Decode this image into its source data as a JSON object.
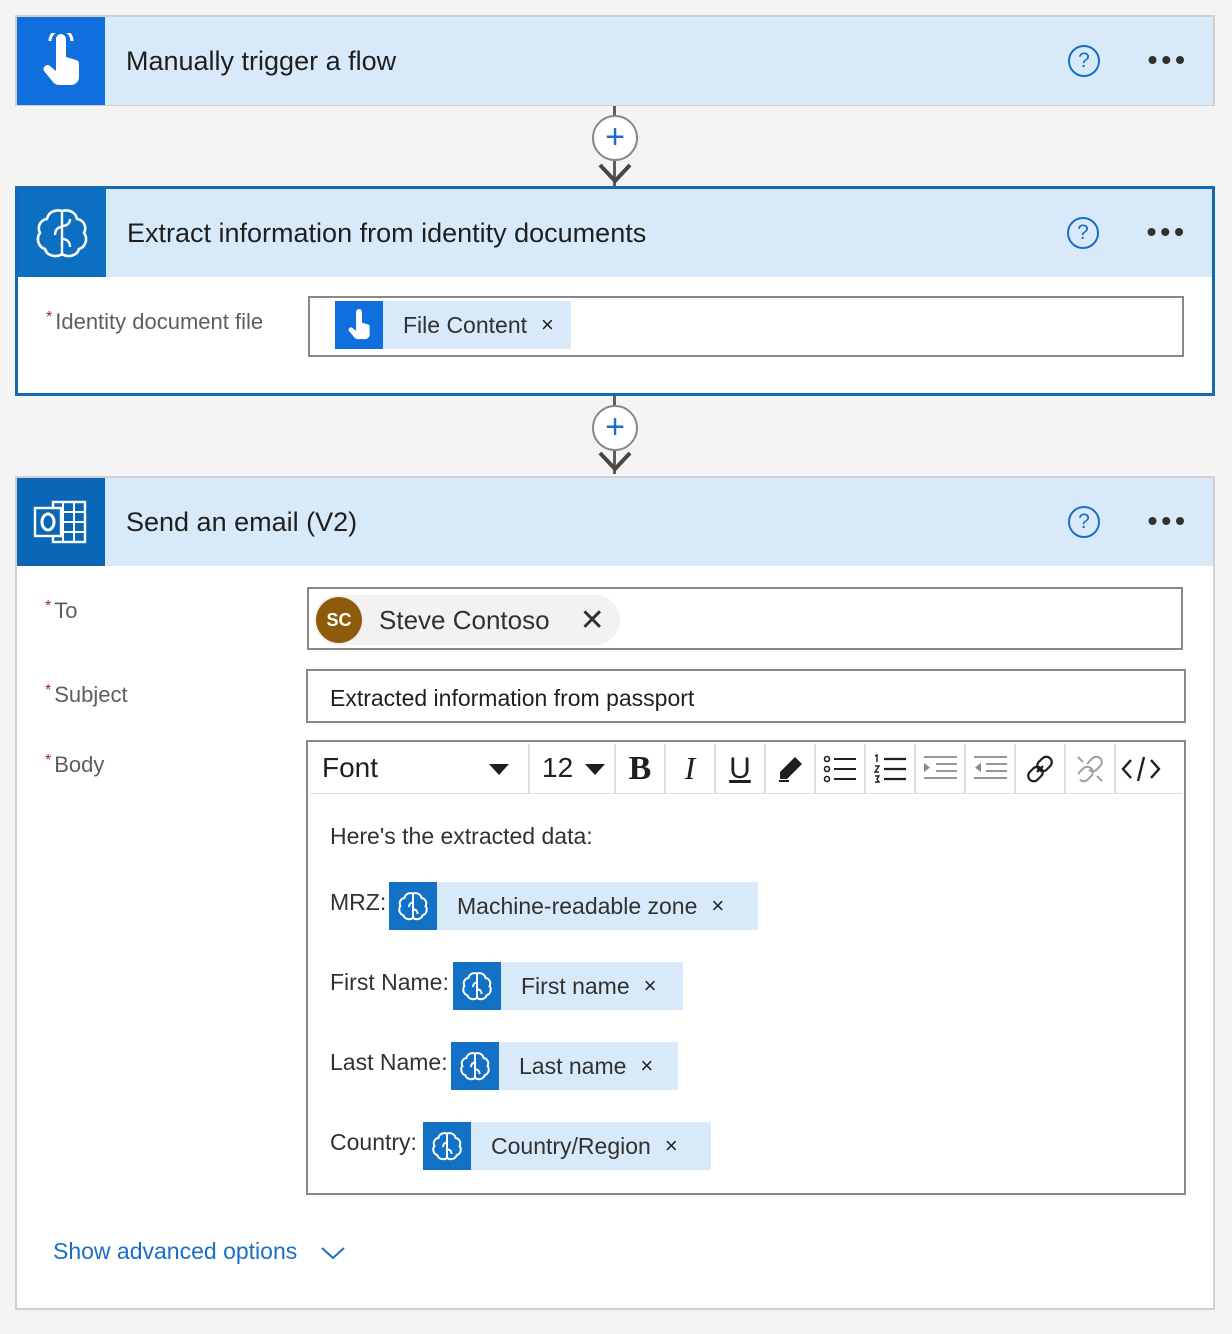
{
  "trigger_card": {
    "title": "Manually trigger a flow",
    "help_icon": "?",
    "more_icon": "•••"
  },
  "extract_card": {
    "title": "Extract information from identity documents",
    "help_icon": "?",
    "more_icon": "•••",
    "field_label": "Identity document file",
    "required_mark": "*",
    "token_label": "File Content",
    "token_remove": "×"
  },
  "email_card": {
    "title": "Send an email (V2)",
    "help_icon": "?",
    "more_icon": "•••",
    "required_mark": "*",
    "to_label": "To",
    "subject_label": "Subject",
    "body_label": "Body",
    "recipient": {
      "initials": "SC",
      "name": "Steve Contoso",
      "remove": "✕"
    },
    "subject_value": "Extracted information from passport",
    "toolbar": {
      "font": "Font",
      "size": "12",
      "bold": "B",
      "italic": "I",
      "underline": "U"
    },
    "body": {
      "intro": "Here's the extracted data:",
      "rows": [
        {
          "label": "MRZ:",
          "token": "Machine-readable zone",
          "remove": "×"
        },
        {
          "label": "First Name:",
          "token": "First name",
          "remove": "×"
        },
        {
          "label": "Last Name:",
          "token": "Last name",
          "remove": "×"
        },
        {
          "label": "Country:",
          "token": "Country/Region",
          "remove": "×"
        }
      ]
    },
    "advanced_link": "Show advanced options"
  },
  "connectors": {
    "plus": "+"
  },
  "colors": {
    "accent": "#1b6ec7",
    "header_bg": "#d8eafa",
    "icon_bg": "#0f6fde",
    "selected_border": "#1569b3",
    "avatar_bg": "#8e5b0b",
    "required": "#a4262c"
  }
}
